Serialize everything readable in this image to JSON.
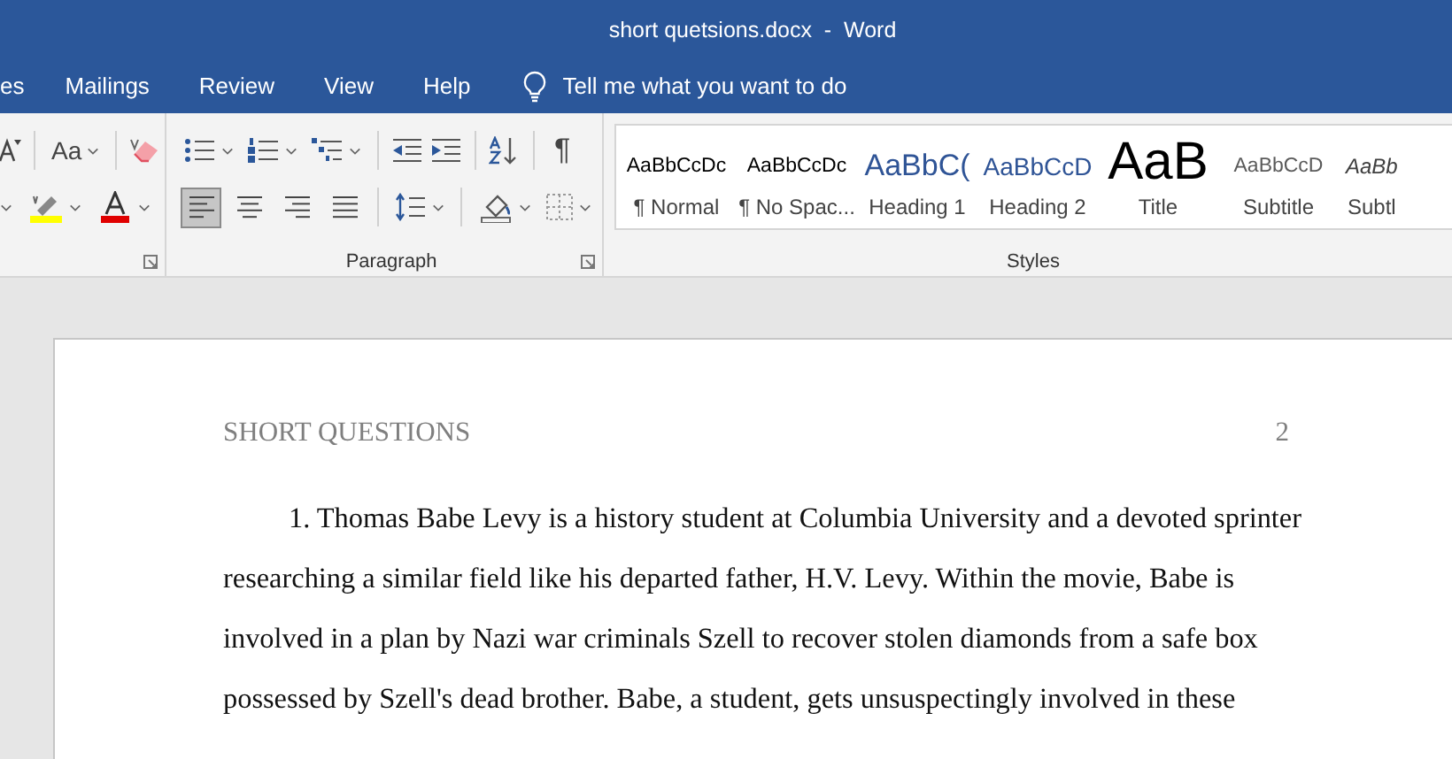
{
  "window": {
    "title": "short quetsions.docx  -  Word"
  },
  "ribbon_tabs": [
    {
      "label": "es"
    },
    {
      "label": "Mailings"
    },
    {
      "label": "Review"
    },
    {
      "label": "View"
    },
    {
      "label": "Help"
    }
  ],
  "tell_me": {
    "placeholder": "Tell me what you want to do"
  },
  "font_group": {
    "change_case": "Aa"
  },
  "paragraph_group": {
    "label": "Paragraph",
    "show_marks": "¶",
    "alignment": [
      {
        "kind": "left",
        "selected": true
      },
      {
        "kind": "center",
        "selected": false
      },
      {
        "kind": "right",
        "selected": false
      },
      {
        "kind": "justify",
        "selected": false
      }
    ]
  },
  "styles_group": {
    "label": "Styles",
    "styles": [
      {
        "kind": "normal",
        "preview": "AaBbCcDc",
        "name": "¶ Normal"
      },
      {
        "kind": "nospace",
        "preview": "AaBbCcDc",
        "name": "¶ No Spac..."
      },
      {
        "kind": "heading1",
        "preview": "AaBbC(",
        "name": "Heading 1"
      },
      {
        "kind": "heading2",
        "preview": "AaBbCcD",
        "name": "Heading 2"
      },
      {
        "kind": "title",
        "preview": "AaB",
        "name": "Title"
      },
      {
        "kind": "subtitle",
        "preview": "AaBbCcD",
        "name": "Subtitle"
      },
      {
        "kind": "emphasis",
        "preview": "AaBb",
        "name": "Subtl"
      }
    ]
  },
  "document": {
    "header": "SHORT QUESTIONS",
    "page_number": "2",
    "paragraph": "1. Thomas Babe Levy is a history student at Columbia University and a devoted sprinter researching a similar field like his departed father, H.V. Levy. Within the movie, Babe is involved in a plan by Nazi war criminals Szell to recover stolen diamonds from a safe box possessed by Szell's dead brother. Babe, a student, gets unsuspectingly involved in these"
  }
}
